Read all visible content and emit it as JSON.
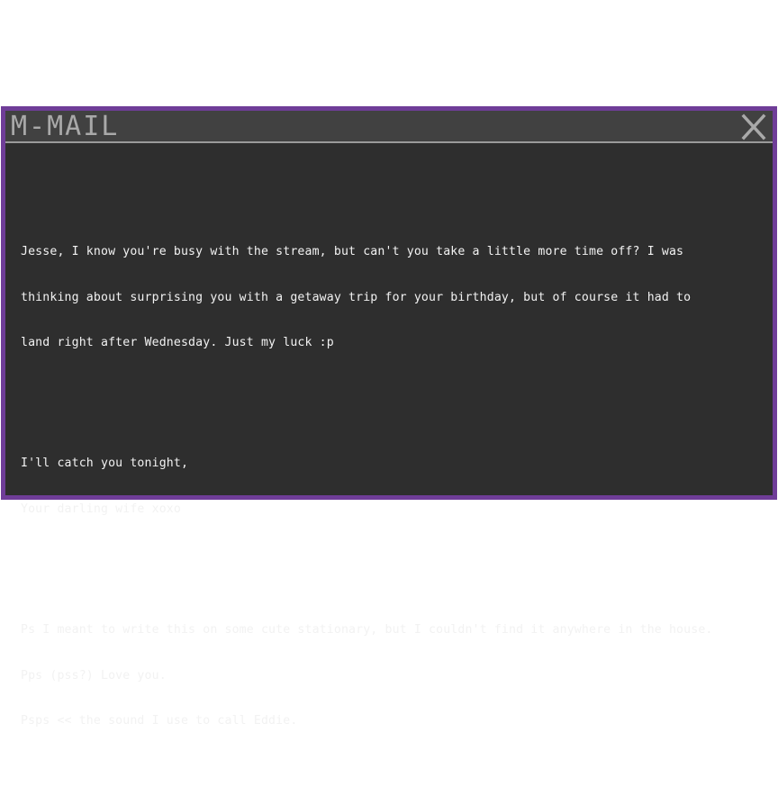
{
  "window": {
    "title": "M-MAIL",
    "close_label": "X"
  },
  "message": {
    "paragraphs": [
      [
        "Jesse, I know you're busy with the stream, but can't you take a little more time off? I was",
        "thinking about surprising you with a getaway trip for your birthday, but of course it had to",
        "land right after Wednesday. Just my luck :p"
      ],
      [
        "I'll catch you tonight,",
        "Your darling wife xoxo"
      ],
      [
        "Ps I meant to write this on some cute stationary, but I couldn't find it anywhere in the house.",
        "Pps (pss?) Love you.",
        "Psps << the sound I use to call Eddie."
      ]
    ]
  },
  "colors": {
    "frame": "#6f3d98",
    "background": "#2e2e2e",
    "titlebar": "#414141",
    "title_text": "#a9a9a9",
    "body_text": "#f2f2f2"
  }
}
